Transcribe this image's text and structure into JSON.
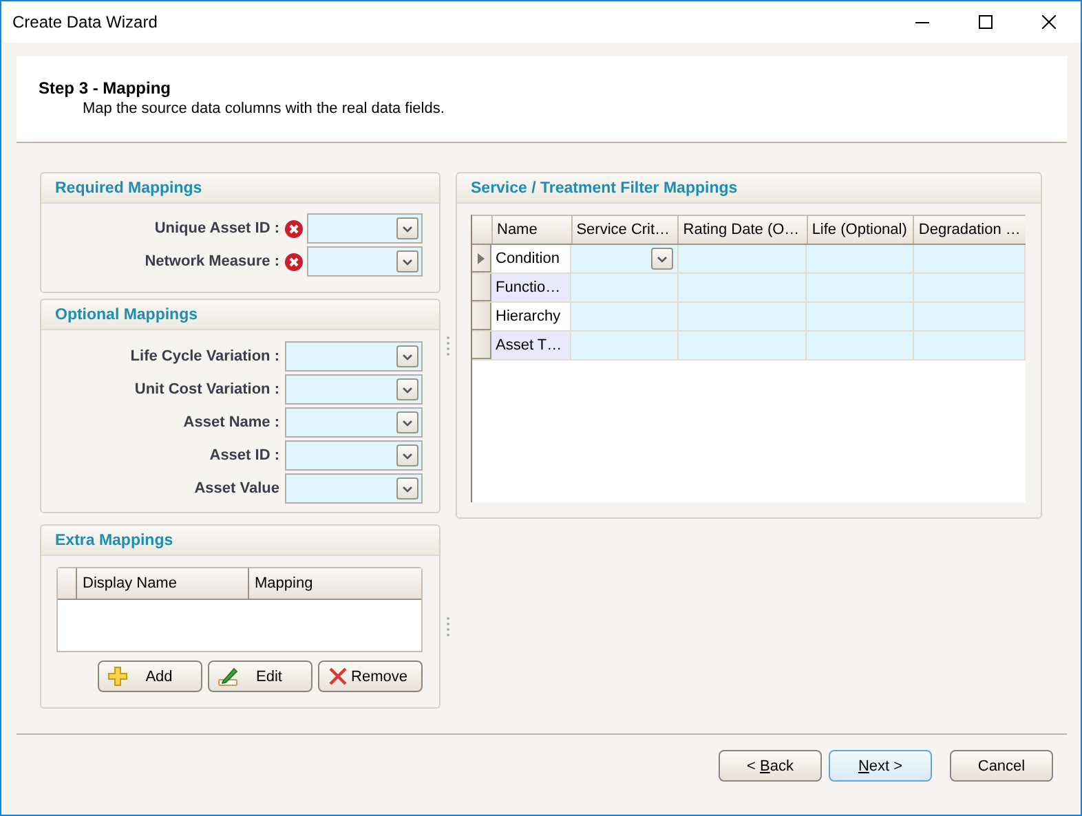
{
  "window": {
    "title": "Create Data Wizard"
  },
  "header": {
    "title": "Step 3 - Mapping",
    "subtitle": "Map the source data columns with the real data fields."
  },
  "groups": [
    {
      "kind": "form",
      "title": "Required Mappings",
      "fields": [
        {
          "label": "Unique Asset ID :",
          "error": true
        },
        {
          "label": "Network Measure :",
          "error": true
        }
      ]
    },
    {
      "kind": "form",
      "title": "Optional Mappings",
      "fields": [
        {
          "label": "Life Cycle Variation :"
        },
        {
          "label": "Unit Cost Variation :"
        },
        {
          "label": "Asset Name :"
        },
        {
          "label": "Asset ID :"
        },
        {
          "label": "Asset Value"
        }
      ]
    },
    {
      "kind": "table",
      "title": "Extra Mappings",
      "columns": [
        "Display Name",
        "Mapping"
      ],
      "buttons": [
        {
          "label": "Add",
          "kind": "add"
        },
        {
          "label": "Edit",
          "kind": "edit"
        },
        {
          "label": "Remove",
          "kind": "remove"
        }
      ]
    }
  ],
  "filter_panel": {
    "title": "Service / Treatment Filter Mappings",
    "columns": [
      "Name",
      "Service Crit…",
      "Rating Date (O…",
      "Life (Optional)",
      "Degradation …"
    ],
    "rows": [
      {
        "name": "Condition",
        "selected": true,
        "shaded": false,
        "dropdown": true
      },
      {
        "name": "Functio…",
        "selected": false,
        "shaded": true,
        "dropdown": false
      },
      {
        "name": "Hierarchy",
        "selected": false,
        "shaded": false,
        "dropdown": false
      },
      {
        "name": "Asset T…",
        "selected": false,
        "shaded": true,
        "dropdown": false
      }
    ]
  },
  "buttons": [
    {
      "before": "< ",
      "mnemonic": "B",
      "after": "ack",
      "default": false
    },
    {
      "mnemonic": "N",
      "after": "ext >",
      "default": true
    },
    {
      "before": "Cancel",
      "default": false
    }
  ]
}
